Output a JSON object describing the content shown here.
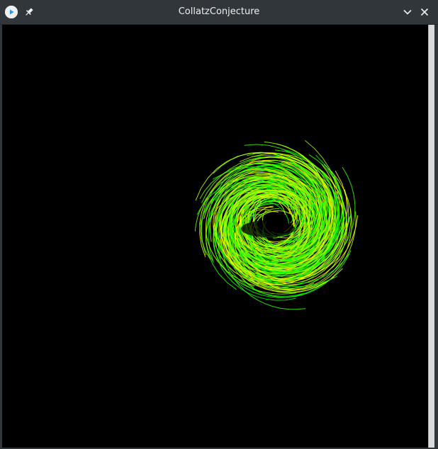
{
  "window": {
    "title": "CollatzConjecture"
  },
  "titlebar_icons": {
    "app": "play-circle-icon",
    "pin": "pin-icon",
    "minimize": "chevron-down-icon",
    "close": "close-icon"
  },
  "canvas": {
    "background": "#000000",
    "stroke_colors": [
      "#ffff00",
      "#ccff00",
      "#99ff00",
      "#66ff00",
      "#33ff00",
      "#00ff00"
    ]
  }
}
